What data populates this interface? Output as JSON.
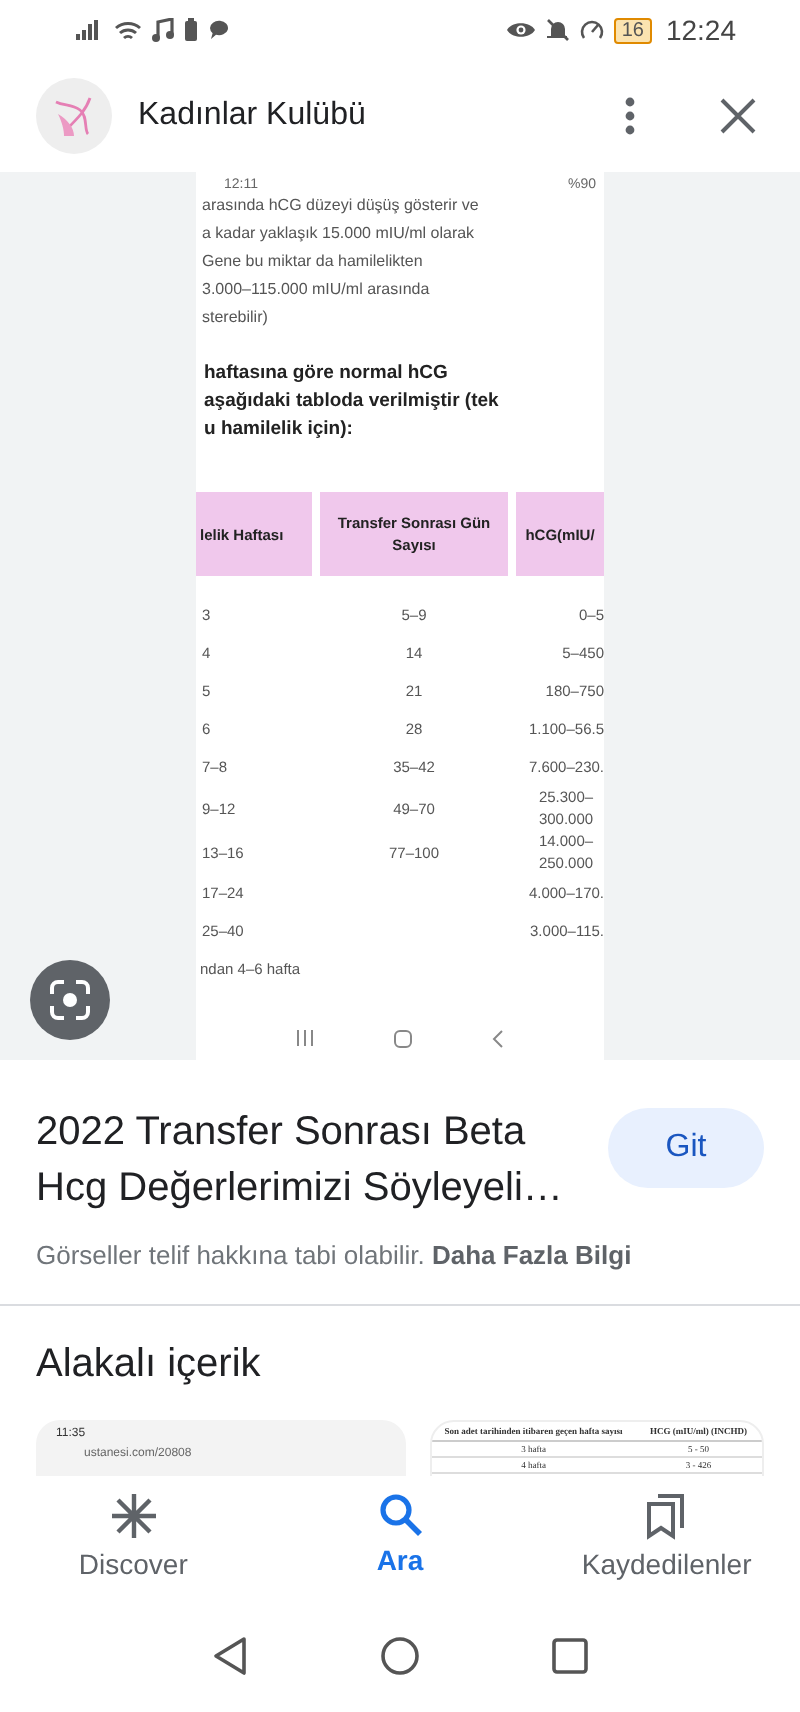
{
  "status_bar": {
    "battery": "16",
    "time": "12:24"
  },
  "header": {
    "title": "Kadınlar Kulübü"
  },
  "shot": {
    "time": "12:11",
    "battery": "%90",
    "lines": [
      "arasında hCG düzeyi düşüş gösterir ve",
      "a kadar yaklaşık 15.000 mIU/ml olarak",
      "Gene bu miktar da hamilelikten",
      "3.000–115.000 mIU/ml arasında",
      "sterebilir)"
    ],
    "heading": [
      "haftasına göre normal hCG",
      "aşağıdaki tabloda verilmiştir (tek",
      "u hamilelik için):"
    ],
    "columns": [
      "lelik Haftası",
      "Transfer Sonrası Gün Sayısı",
      "hCG(mIU/"
    ],
    "rows": [
      [
        "3",
        "5–9",
        "0–5"
      ],
      [
        "4",
        "14",
        "5–450"
      ],
      [
        "5",
        "21",
        "180–750"
      ],
      [
        "6",
        "28",
        "1.100–56.5"
      ],
      [
        "7–8",
        "35–42",
        "7.600–230."
      ],
      [
        "9–12",
        "49–70",
        "25.300–300.000"
      ],
      [
        "13–16",
        "77–100",
        "14.000–250.000"
      ],
      [
        "17–24",
        "",
        "4.000–170."
      ],
      [
        "25–40",
        "",
        "3.000–115."
      ]
    ],
    "footer": "ndan 4–6 hafta"
  },
  "result": {
    "title": "2022 Transfer Sonrası Beta Hcg Değerlerimizi Söyleyeli…",
    "button": "Git",
    "notice": "Görseller telif hakkına tabi olabilir.",
    "more": "Daha Fazla Bilgi"
  },
  "related": {
    "heading": "Alakalı içerik",
    "thumb_1": {
      "time": "11:35",
      "url": "ustanesi.com/20808"
    },
    "thumb_2": {
      "columns": [
        "Son adet tarihinden itibaren geçen hafta sayısı",
        "HCG (mIU/ml) (INCHD)"
      ],
      "rows": [
        [
          "3 hafta",
          "5 - 50"
        ],
        [
          "4 hafta",
          "3 - 426"
        ]
      ]
    }
  },
  "nav": [
    {
      "kind": "discover",
      "label": "Discover",
      "selected": false
    },
    {
      "kind": "search",
      "label": "Ara",
      "selected": true
    },
    {
      "kind": "saved",
      "label": "Kaydedilenler",
      "selected": false
    }
  ]
}
